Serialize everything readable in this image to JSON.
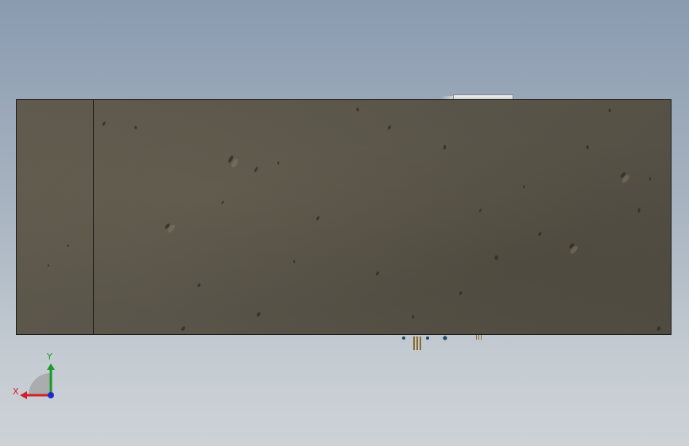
{
  "viewport": {
    "colors": {
      "background_top": "#8a9bb0",
      "background_bottom": "#cdd2d7",
      "model_face": "#5a554a",
      "model_edge": "#1e1d1a"
    }
  },
  "triad": {
    "x_label": "X",
    "y_label": "Y",
    "colors": {
      "x_axis": "#d0202a",
      "y_axis": "#1a9a2a",
      "z_axis": "#1a2acc"
    }
  }
}
